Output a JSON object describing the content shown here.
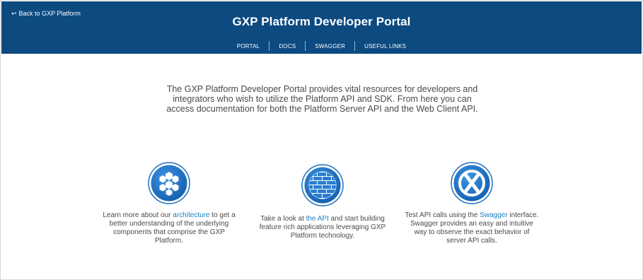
{
  "header": {
    "back_arrow": "↩",
    "back_label": "Back to GXP Platform",
    "title": "GXP Platform Developer Portal",
    "nav": [
      "PORTAL",
      "DOCS",
      "SWAGGER",
      "USEFUL LINKS"
    ],
    "bg_color": "#0c4a80"
  },
  "intro": "The GXP Platform Developer Portal provides vital resources for developers and integrators who wish to utilize the Platform API and SDK. From here you can access documentation for both the Platform Server API and the Web Client API.",
  "features": [
    {
      "icon": "hexagon-cluster-icon",
      "before": "Learn more about our ",
      "link": "architecture",
      "after": " to get a better understanding of the underlying components that comprise the GXP Platform."
    },
    {
      "icon": "brick-globe-icon",
      "before": "Take a look at ",
      "link": "the API",
      "after": " and start building feature rich applications leveraging GXP Platform technology."
    },
    {
      "icon": "swagger-x-icon",
      "before": "Test API calls using the ",
      "link": "Swagger",
      "after": " interface. Swagger provides an easy and intuitive way to observe the exact behavior of server API calls."
    }
  ],
  "colors": {
    "accent_blue": "#1d80c4",
    "icon_blue": "#1e6fc0"
  }
}
